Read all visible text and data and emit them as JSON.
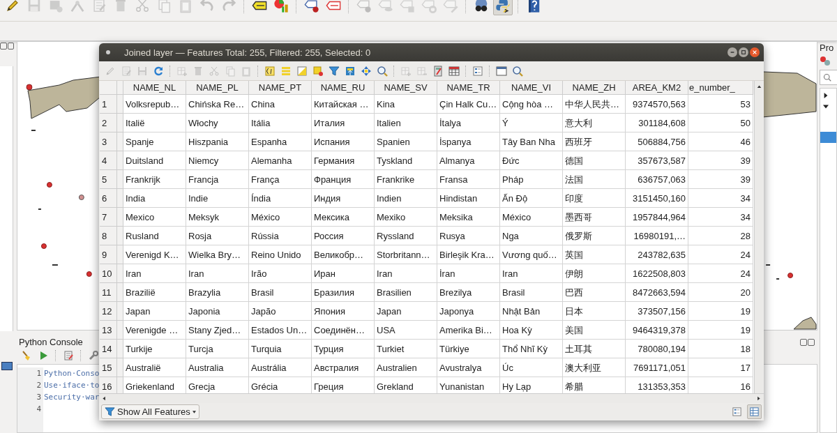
{
  "main_toolbar": [
    {
      "kind": "pencil",
      "disabled": false,
      "pressed": false
    },
    {
      "kind": "floppy",
      "disabled": true,
      "pressed": false
    },
    {
      "kind": "layer-save",
      "disabled": true,
      "pressed": false
    },
    {
      "kind": "node-tool",
      "disabled": true,
      "pressed": false
    },
    {
      "kind": "edit-sheet",
      "disabled": true,
      "pressed": false
    },
    {
      "kind": "trash",
      "disabled": true,
      "pressed": false
    },
    {
      "kind": "scissors",
      "disabled": true,
      "pressed": false
    },
    {
      "kind": "copy",
      "disabled": true,
      "pressed": false
    },
    {
      "kind": "paste",
      "disabled": true,
      "pressed": false
    },
    {
      "kind": "undo",
      "disabled": true,
      "pressed": false
    },
    {
      "kind": "redo",
      "disabled": true,
      "pressed": false
    },
    {
      "kind": "sep"
    },
    {
      "kind": "label-tag",
      "disabled": false,
      "pressed": false
    },
    {
      "kind": "chart",
      "disabled": false,
      "pressed": false
    },
    {
      "kind": "sep"
    },
    {
      "kind": "label-pin",
      "disabled": false,
      "pressed": false
    },
    {
      "kind": "label-red",
      "disabled": false,
      "pressed": false
    },
    {
      "kind": "sep"
    },
    {
      "kind": "label-pin",
      "disabled": true,
      "pressed": false
    },
    {
      "kind": "label-eye",
      "disabled": true,
      "pressed": false
    },
    {
      "kind": "label-move",
      "disabled": true,
      "pressed": false
    },
    {
      "kind": "label-rotate",
      "disabled": true,
      "pressed": false
    },
    {
      "kind": "label-edit",
      "disabled": true,
      "pressed": false
    },
    {
      "kind": "sep"
    },
    {
      "kind": "binoculars",
      "disabled": false,
      "pressed": false
    },
    {
      "kind": "python",
      "disabled": false,
      "pressed": true
    },
    {
      "kind": "sep"
    },
    {
      "kind": "help",
      "disabled": false,
      "pressed": false
    }
  ],
  "right_panel": {
    "title": "Pro",
    "items": [
      {
        "kind": "branch",
        "expanded": false,
        "selected": false
      },
      {
        "kind": "branch",
        "expanded": true,
        "selected": false
      },
      {
        "kind": "leaf",
        "selected": true
      }
    ]
  },
  "python_console": {
    "title": "Python Console",
    "toolbar": [
      {
        "kind": "broom"
      },
      {
        "kind": "play"
      },
      {
        "kind": "sep"
      },
      {
        "kind": "edit-sheet"
      },
      {
        "kind": "sep"
      },
      {
        "kind": "wrench"
      }
    ],
    "lines": [
      {
        "number": "1",
        "text": "Python·Conso"
      },
      {
        "number": "2",
        "text": "Use·iface·to"
      },
      {
        "number": "3",
        "text": "Security·war"
      },
      {
        "number": "4"
      }
    ]
  },
  "attribute_table": {
    "title": "Joined layer — Features Total: 255, Filtered: 255, Selected: 0",
    "toolbar": [
      {
        "kind": "pencil",
        "disabled": true
      },
      {
        "kind": "edit-sheet",
        "disabled": true
      },
      {
        "kind": "floppy",
        "disabled": true
      },
      {
        "kind": "refresh",
        "disabled": false
      },
      {
        "kind": "sep"
      },
      {
        "kind": "table-plus",
        "disabled": true
      },
      {
        "kind": "trash",
        "disabled": true
      },
      {
        "kind": "scissors",
        "disabled": true
      },
      {
        "kind": "copy",
        "disabled": true
      },
      {
        "kind": "paste",
        "disabled": true
      },
      {
        "kind": "sep"
      },
      {
        "kind": "select-expr",
        "disabled": false
      },
      {
        "kind": "select-all",
        "disabled": false
      },
      {
        "kind": "invert",
        "disabled": false
      },
      {
        "kind": "deselect",
        "disabled": false
      },
      {
        "kind": "filter",
        "disabled": false
      },
      {
        "kind": "move-top",
        "disabled": false
      },
      {
        "kind": "pan",
        "disabled": false
      },
      {
        "kind": "zoom",
        "disabled": false
      },
      {
        "kind": "sep"
      },
      {
        "kind": "table-plus",
        "disabled": true
      },
      {
        "kind": "table-minus",
        "disabled": true
      },
      {
        "kind": "calculator",
        "disabled": false
      },
      {
        "kind": "grid",
        "disabled": false
      },
      {
        "kind": "sep"
      },
      {
        "kind": "form",
        "disabled": false
      },
      {
        "kind": "sep"
      },
      {
        "kind": "dock",
        "disabled": false
      },
      {
        "kind": "zoom",
        "disabled": false
      }
    ],
    "columns": [
      "NAME_NL",
      "NAME_PL",
      "NAME_PT",
      "NAME_RU",
      "NAME_SV",
      "NAME_TR",
      "NAME_VI",
      "NAME_ZH",
      "AREA_KM2",
      "e_number_"
    ],
    "rows": [
      {
        "number": "1",
        "cells": [
          "Volksrepub…",
          "Chińska Re…",
          "China",
          "Китайская …",
          "Kina",
          "Çin Halk Cu…",
          "Cộng hòa …",
          "中华人民共…",
          "9374570,563",
          "53"
        ]
      },
      {
        "number": "2",
        "cells": [
          "Italië",
          "Włochy",
          "Itália",
          "Италия",
          "Italien",
          "İtalya",
          "Ý",
          "意大利",
          "301184,608",
          "50"
        ]
      },
      {
        "number": "3",
        "cells": [
          "Spanje",
          "Hiszpania",
          "Espanha",
          "Испания",
          "Spanien",
          "İspanya",
          "Tây Ban Nha",
          "西班牙",
          "506884,756",
          "46"
        ]
      },
      {
        "number": "4",
        "cells": [
          "Duitsland",
          "Niemcy",
          "Alemanha",
          "Германия",
          "Tyskland",
          "Almanya",
          "Đức",
          "德国",
          "357673,587",
          "39"
        ]
      },
      {
        "number": "5",
        "cells": [
          "Frankrijk",
          "Francja",
          "França",
          "Франция",
          "Frankrike",
          "Fransa",
          "Pháp",
          "法国",
          "636757,063",
          "39"
        ]
      },
      {
        "number": "6",
        "cells": [
          "India",
          "Indie",
          "Índia",
          "Индия",
          "Indien",
          "Hindistan",
          "Ấn Độ",
          "印度",
          "3151450,160",
          "34"
        ]
      },
      {
        "number": "7",
        "cells": [
          "Mexico",
          "Meksyk",
          "México",
          "Мексика",
          "Mexiko",
          "Meksika",
          "México",
          "墨西哥",
          "1957844,964",
          "34"
        ]
      },
      {
        "number": "8",
        "cells": [
          "Rusland",
          "Rosja",
          "Rússia",
          "Россия",
          "Ryssland",
          "Rusya",
          "Nga",
          "俄罗斯",
          "16980191,…",
          "28"
        ]
      },
      {
        "number": "9",
        "cells": [
          "Verenigd K…",
          "Wielka Bry…",
          "Reino Unido",
          "Великобр…",
          "Storbritann…",
          "Birleşik Kra…",
          "Vương quố…",
          "英国",
          "243782,635",
          "24"
        ]
      },
      {
        "number": "10",
        "cells": [
          "Iran",
          "Iran",
          "Irão",
          "Иран",
          "Iran",
          "İran",
          "Iran",
          "伊朗",
          "1622508,803",
          "24"
        ]
      },
      {
        "number": "11",
        "cells": [
          "Brazilië",
          "Brazylia",
          "Brasil",
          "Бразилия",
          "Brasilien",
          "Brezilya",
          "Brasil",
          "巴西",
          "8472663,594",
          "20"
        ]
      },
      {
        "number": "12",
        "cells": [
          "Japan",
          "Japonia",
          "Japão",
          "Япония",
          "Japan",
          "Japonya",
          "Nhật Bản",
          "日本",
          "373507,156",
          "19"
        ]
      },
      {
        "number": "13",
        "cells": [
          "Verenigde …",
          "Stany Zjed…",
          "Estados Un…",
          "Соединён…",
          "USA",
          "Amerika Bi…",
          "Hoa Kỳ",
          "美国",
          "9464319,378",
          "19"
        ]
      },
      {
        "number": "14",
        "cells": [
          "Turkije",
          "Turcja",
          "Turquia",
          "Турция",
          "Turkiet",
          "Türkiye",
          "Thổ Nhĩ Kỳ",
          "土耳其",
          "780080,194",
          "18"
        ]
      },
      {
        "number": "15",
        "cells": [
          "Australië",
          "Australia",
          "Austrália",
          "Австралия",
          "Australien",
          "Avustralya",
          "Úc",
          "澳大利亚",
          "7691171,051",
          "17"
        ]
      },
      {
        "number": "16",
        "cells": [
          "Griekenland",
          "Grecja",
          "Grécia",
          "Греция",
          "Grekland",
          "Yunanistan",
          "Hy Lạp",
          "希腊",
          "131353,353",
          "16"
        ]
      }
    ],
    "filter_button": "Show All Features",
    "view_buttons": [
      {
        "kind": "form",
        "pressed": false
      },
      {
        "kind": "table",
        "pressed": true
      }
    ]
  }
}
